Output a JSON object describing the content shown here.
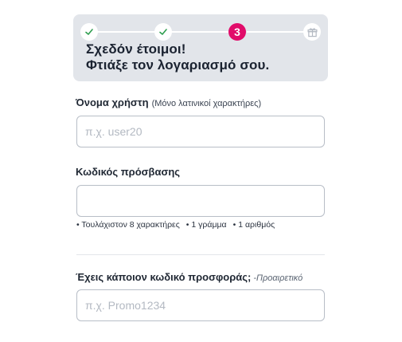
{
  "steps": [
    {
      "state": "done",
      "icon": "check-icon"
    },
    {
      "state": "done",
      "icon": "check-icon"
    },
    {
      "state": "current",
      "label": "3"
    },
    {
      "state": "upcoming",
      "icon": "gift-icon"
    }
  ],
  "colors": {
    "accent": "#e10c6a",
    "check": "#2e9e4f",
    "panel": "#e2e5ea"
  },
  "headline": {
    "line1": "Σχεδόν έτοιμοι!",
    "line2": "Φτιάξε τον λογαριασμό σου."
  },
  "username": {
    "label": "Όνομα χρήστη",
    "hint": "(Μόνο λατινικοί χαρακτήρες)",
    "placeholder": "π.χ. user20"
  },
  "password": {
    "label": "Κωδικός πρόσβασης",
    "rules": [
      "Τουλάχιστον 8 χαρακτήρες",
      "1 γράμμα",
      "1 αριθμός"
    ]
  },
  "promo": {
    "label": "Έχεις κάποιον κωδικό προσφοράς;",
    "optional": "-Προαιρετικό",
    "placeholder": "π.χ. Promo1234"
  }
}
